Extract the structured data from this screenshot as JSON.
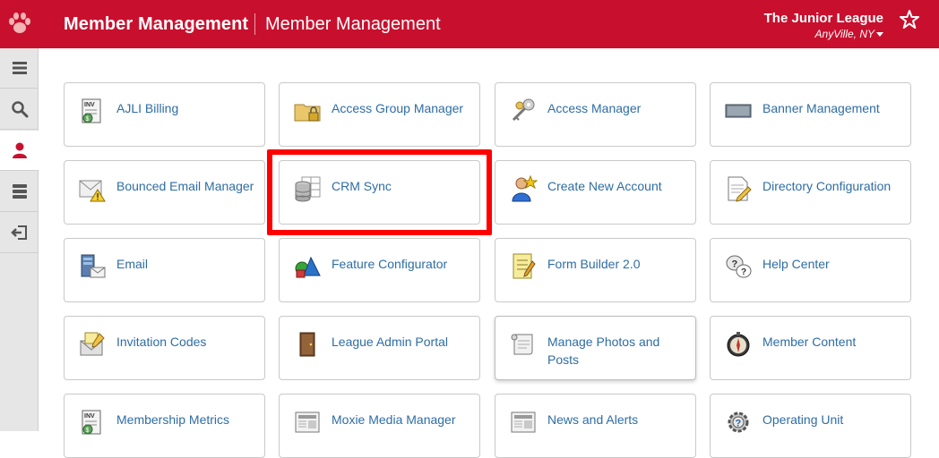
{
  "header": {
    "app_title": "Member Management",
    "page_title": "Member Management",
    "org_name": "The Junior League",
    "org_location": "AnyVille, NY"
  },
  "sidebar": {
    "items": [
      {
        "icon": "menu-icon"
      },
      {
        "icon": "search-icon"
      },
      {
        "icon": "user-icon",
        "active": true
      },
      {
        "icon": "server-icon"
      },
      {
        "icon": "logout-icon"
      }
    ]
  },
  "tiles": [
    {
      "label": "AJLI Billing",
      "icon": "invoice-icon"
    },
    {
      "label": "Access Group Manager",
      "icon": "locked-folder-icon"
    },
    {
      "label": "Access Manager",
      "icon": "keys-icon"
    },
    {
      "label": "Banner Management",
      "icon": "banner-icon"
    },
    {
      "label": "Bounced Email Manager",
      "icon": "envelope-warning-icon"
    },
    {
      "label": "CRM Sync",
      "icon": "database-table-icon",
      "highlighted": true
    },
    {
      "label": "Create New Account",
      "icon": "new-user-icon"
    },
    {
      "label": "Directory Configuration",
      "icon": "document-pencil-icon"
    },
    {
      "label": "Email",
      "icon": "email-server-icon"
    },
    {
      "label": "Feature Configurator",
      "icon": "shapes-icon"
    },
    {
      "label": "Form Builder 2.0",
      "icon": "form-icon"
    },
    {
      "label": "Help Center",
      "icon": "question-bubbles-icon"
    },
    {
      "label": "Invitation Codes",
      "icon": "invitation-icon"
    },
    {
      "label": "League Admin Portal",
      "icon": "door-icon"
    },
    {
      "label": "Manage Photos and Posts",
      "icon": "scroll-icon"
    },
    {
      "label": "Member Content",
      "icon": "compass-icon"
    },
    {
      "label": "Membership Metrics",
      "icon": "invoice-icon"
    },
    {
      "label": "Moxie Media Manager",
      "icon": "newspaper-icon"
    },
    {
      "label": "News and Alerts",
      "icon": "newspaper-icon"
    },
    {
      "label": "Operating Unit",
      "icon": "gear-question-icon"
    }
  ],
  "colors": {
    "header_bg": "#c8102e",
    "link_text": "#2e6da4",
    "highlight_border": "#ff0000"
  }
}
